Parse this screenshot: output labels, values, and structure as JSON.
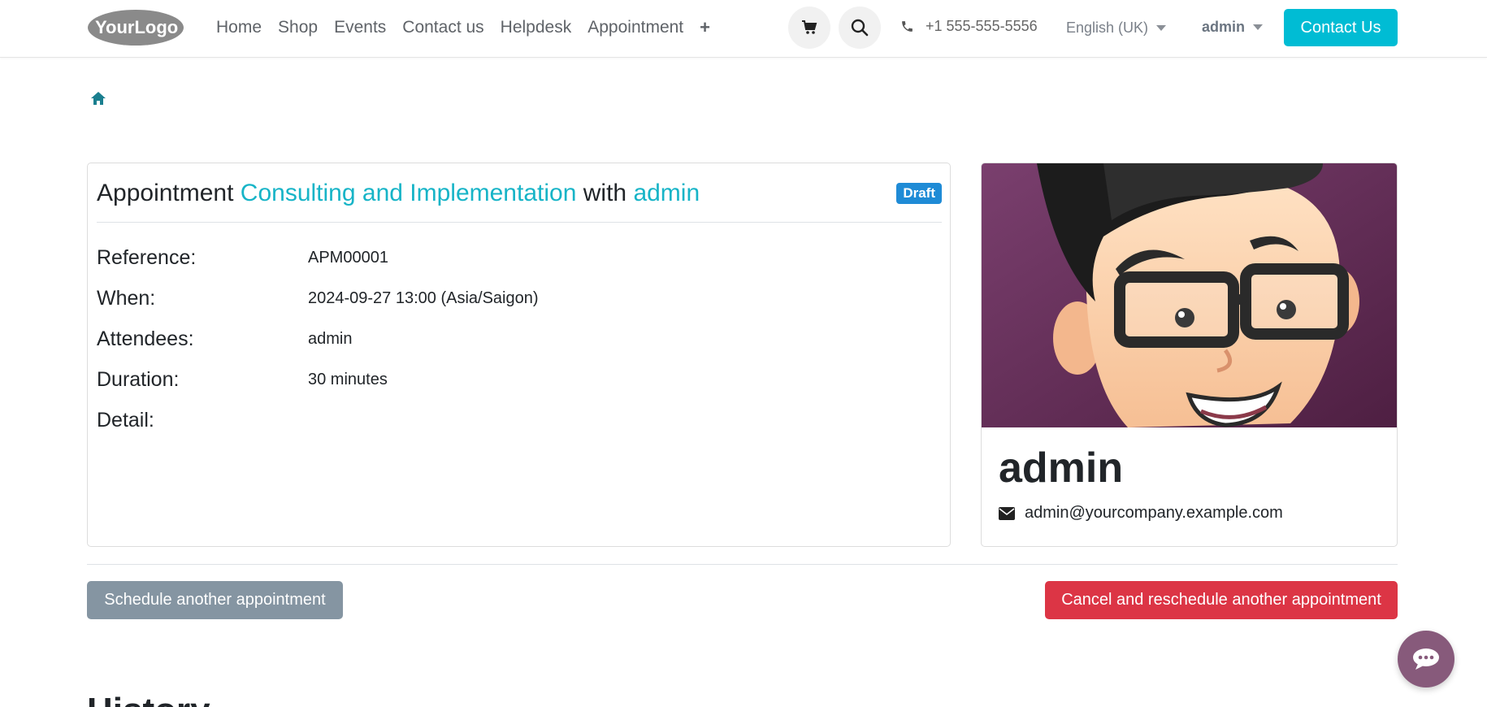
{
  "header": {
    "logo_text": "YourLogo",
    "nav": [
      "Home",
      "Shop",
      "Events",
      "Contact us",
      "Helpdesk",
      "Appointment"
    ],
    "add_icon": "+",
    "phone": "+1 555-555-5556",
    "language": "English (UK)",
    "user": "admin",
    "contact_button": "Contact Us"
  },
  "breadcrumb": {
    "home_icon": "home-icon"
  },
  "appointment": {
    "title_prefix": "Appointment",
    "type_name": "Consulting and Implementation",
    "title_with": "with",
    "staff_name": "admin",
    "status": "Draft",
    "fields": [
      {
        "label": "Reference:",
        "value": "APM00001"
      },
      {
        "label": "When:",
        "value": "2024-09-27 13:00 (Asia/Saigon)"
      },
      {
        "label": "Attendees:",
        "value": "admin"
      },
      {
        "label": "Duration:",
        "value": "30 minutes"
      },
      {
        "label": "Detail:",
        "value": ""
      }
    ]
  },
  "profile": {
    "name": "admin",
    "email": "admin@yourcompany.example.com"
  },
  "actions": {
    "schedule": "Schedule another appointment",
    "cancel": "Cancel and reschedule another appointment"
  },
  "history_title": "History",
  "colors": {
    "accent": "#00bcd4",
    "link": "#17b4c7",
    "draft_badge": "#1f8bd6",
    "danger": "#dc3545",
    "secondary": "#8595a2",
    "chat": "#875a7b"
  }
}
